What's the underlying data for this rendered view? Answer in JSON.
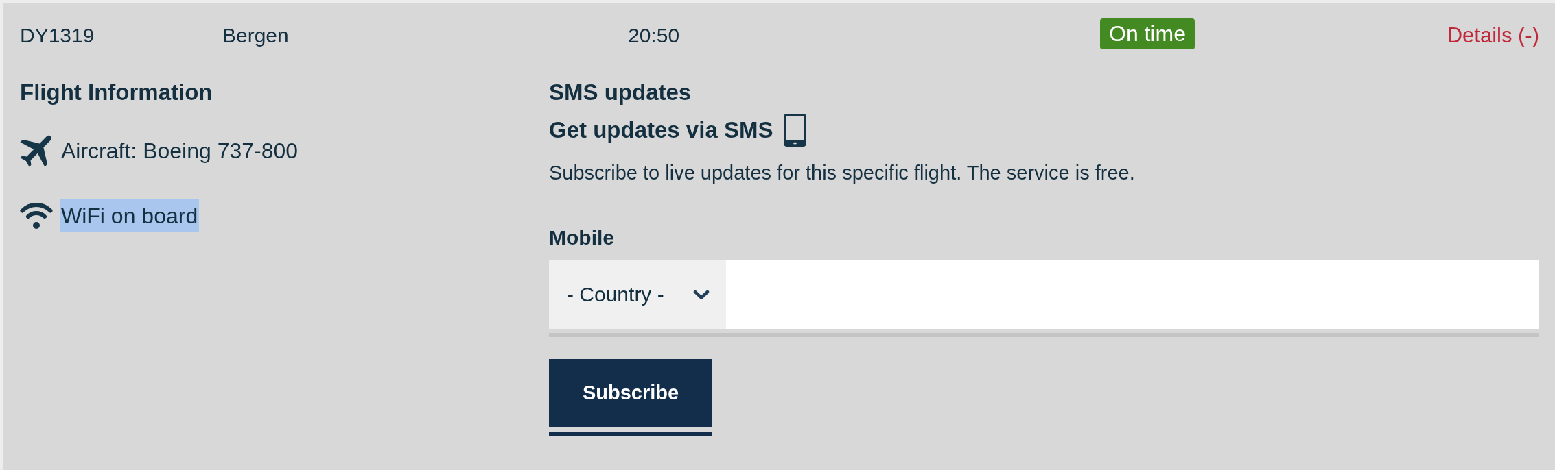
{
  "flight_row": {
    "flight_number": "DY1319",
    "destination": "Bergen",
    "time": "20:50",
    "status": {
      "label": "On time",
      "kind": "on_time"
    },
    "details_link": "Details (-)"
  },
  "flight_information": {
    "title": "Flight Information",
    "features": [
      {
        "kind": "aircraft",
        "label": "Aircraft: Boeing 737-800",
        "text_selected": false
      },
      {
        "kind": "wifi",
        "label": "WiFi on board",
        "text_selected": true
      }
    ]
  },
  "sms_updates": {
    "title": "SMS updates",
    "subtitle": "Get updates via SMS",
    "description": "Subscribe to live updates for this specific flight. The service is free.",
    "mobile_label": "Mobile",
    "country_select": {
      "value": "- Country -"
    },
    "subscribe_button": "Subscribe"
  }
}
